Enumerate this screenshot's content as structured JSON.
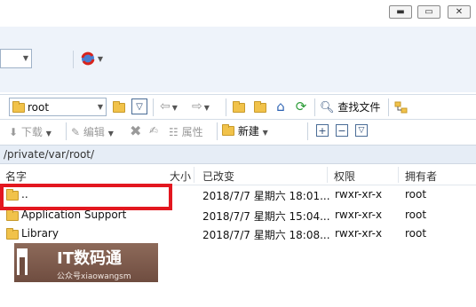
{
  "window": {
    "minimize_glyph": "▬",
    "maximize_glyph": "▭",
    "close_glyph": "✕"
  },
  "toolbar1": {
    "combo_value": ""
  },
  "toolbar2": {
    "dir_combo_value": "root",
    "find_files_label": "查找文件"
  },
  "toolbar3": {
    "download_label": "下载",
    "edit_label": "编辑",
    "properties_label": "属性",
    "new_label": "新建",
    "plus_glyph": "+",
    "minus_glyph": "−",
    "filter_glyph": "▽"
  },
  "path": "/private/var/root/",
  "columns": {
    "name": "名字",
    "size": "大小",
    "modified": "已改变",
    "permissions": "权限",
    "owner": "拥有者"
  },
  "rows": [
    {
      "name": "..",
      "size": "",
      "modified": "2018/7/7 星期六 18:01...",
      "permissions": "rwxr-xr-x",
      "owner": "root"
    },
    {
      "name": "Application Support",
      "size": "",
      "modified": "2018/7/7 星期六 15:04...",
      "permissions": "rwxr-xr-x",
      "owner": "root"
    },
    {
      "name": "Library",
      "size": "",
      "modified": "2018/7/7 星期六 18:08...",
      "permissions": "rwxr-xr-x",
      "owner": "root"
    }
  ],
  "watermark": {
    "title": "IT数码通",
    "subtitle": "公众号xiaowangsm"
  },
  "colors": {
    "highlight_box": "#e3171f",
    "toolbar_bg": "#eef3fa",
    "folder": "#f1c24a"
  }
}
